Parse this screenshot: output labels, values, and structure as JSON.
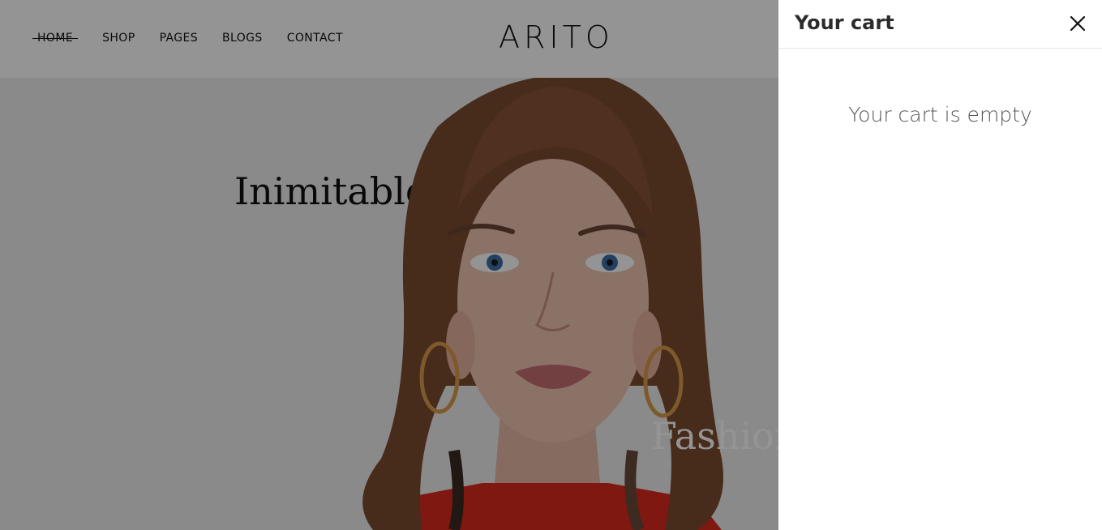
{
  "header": {
    "nav": [
      {
        "label": "HOME",
        "active": true
      },
      {
        "label": "SHOP"
      },
      {
        "label": "PAGES"
      },
      {
        "label": "BLOGS"
      },
      {
        "label": "CONTACT"
      }
    ],
    "logo": "ARITO"
  },
  "hero": {
    "title_line_1": "Inimitable",
    "title_line_2": "Fashion"
  },
  "cart": {
    "title": "Your cart",
    "empty_message": "Your cart is empty",
    "close_icon": "close-icon"
  },
  "colors": {
    "overlay": "rgba(0,0,0,0.42)",
    "text_dark": "#111111",
    "cart_title": "#2b2b2b",
    "cart_empty_text": "#555555",
    "hero_background": "#eeeeee",
    "top_red": "#d92a1c"
  }
}
